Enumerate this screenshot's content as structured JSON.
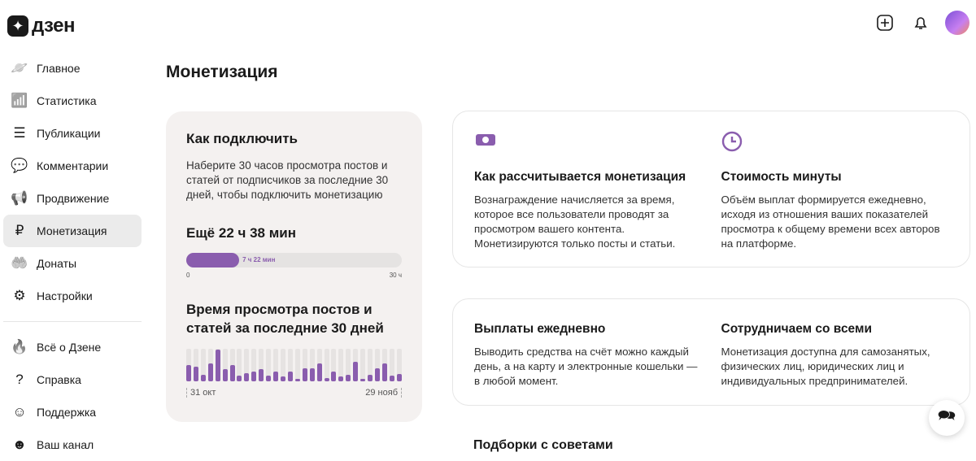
{
  "app": {
    "logo": "дзен"
  },
  "nav": [
    {
      "label": "Главное",
      "icon": "planet-icon"
    },
    {
      "label": "Статистика",
      "icon": "bar-chart-icon"
    },
    {
      "label": "Публикации",
      "icon": "stack-icon"
    },
    {
      "label": "Комментарии",
      "icon": "comment-icon"
    },
    {
      "label": "Продвижение",
      "icon": "megaphone-icon"
    },
    {
      "label": "Монетизация",
      "icon": "ruble-icon",
      "active": true
    },
    {
      "label": "Донаты",
      "icon": "hand-coin-icon"
    },
    {
      "label": "Настройки",
      "icon": "gear-icon"
    }
  ],
  "nav2": [
    {
      "label": "Всё о Дзене",
      "icon": "flame-icon"
    },
    {
      "label": "Справка",
      "icon": "help-icon"
    },
    {
      "label": "Поддержка",
      "icon": "chat-icon"
    },
    {
      "label": "Ваш канал",
      "icon": "channel-icon"
    }
  ],
  "page": {
    "title": "Монетизация"
  },
  "connect": {
    "title": "Как подключить",
    "text": "Наберите 30 часов просмотра постов и статей от подписчиков за последние 30 дней, чтобы подключить монетизацию",
    "remaining": "Ещё 22 ч 38 мин",
    "progress_label": "7 ч 22 мин",
    "progress_fraction": 0.2456,
    "axis_min": "0",
    "axis_max": "30 ч",
    "chart_title": "Время просмотра постов и статей за последние 30 дней",
    "date_start": "31 окт",
    "date_end": "29 нояб",
    "bars": [
      0.5,
      0.46,
      0.21,
      0.54,
      0.98,
      0.38,
      0.5,
      0.18,
      0.25,
      0.31,
      0.38,
      0.18,
      0.31,
      0.15,
      0.31,
      0.07,
      0.4,
      0.4,
      0.54,
      0.11,
      0.31,
      0.15,
      0.21,
      0.61,
      0.07,
      0.21,
      0.4,
      0.54,
      0.18,
      0.23
    ]
  },
  "info": [
    {
      "title": "Как рассчитывается монетизация",
      "text": "Вознаграждение начисляется за время, которое все пользователи проводят за просмотром вашего контента. Монетизируются только посты и статьи."
    },
    {
      "title": "Стоимость минуты",
      "text": "Объём выплат формируется ежедневно, исходя из отношения ваших показателей просмотра к общему времени всех авторов на платформе."
    },
    {
      "title": "Выплаты ежедневно",
      "text": "Выводить средства на счёт можно каждый день, а на карту и электронные кошельки — в любой момент."
    },
    {
      "title": "Сотрудничаем со всеми",
      "text": "Монетизация доступна для самозанятых, физических лиц, юридических лиц и индивидуальных предпринимателей."
    }
  ],
  "tips_title": "Подборки с советами"
}
